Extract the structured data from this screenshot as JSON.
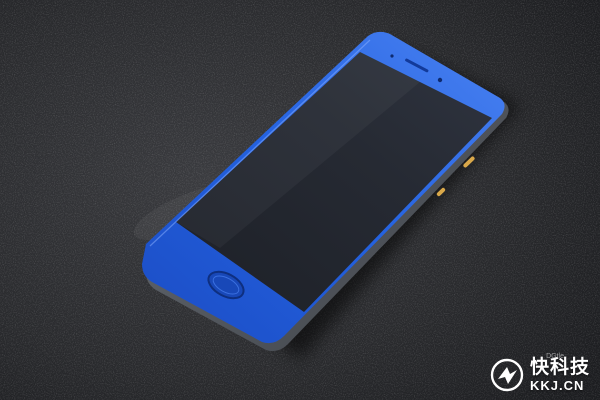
{
  "photo": {
    "subject": "smartphone-blue",
    "colors": {
      "phone_body": "#1e56d6",
      "phone_highlight": "#3f78f0",
      "screen": "#242830",
      "frame_metal": "#5a5f66",
      "surface": "#2a2a2c",
      "accent_gold": "#d9a84a"
    }
  },
  "watermark": {
    "site_name": "快科技",
    "domain": "KKJ.CN",
    "icon": "kkj-logo-icon"
  },
  "credit": {
    "text": "DGtle"
  }
}
